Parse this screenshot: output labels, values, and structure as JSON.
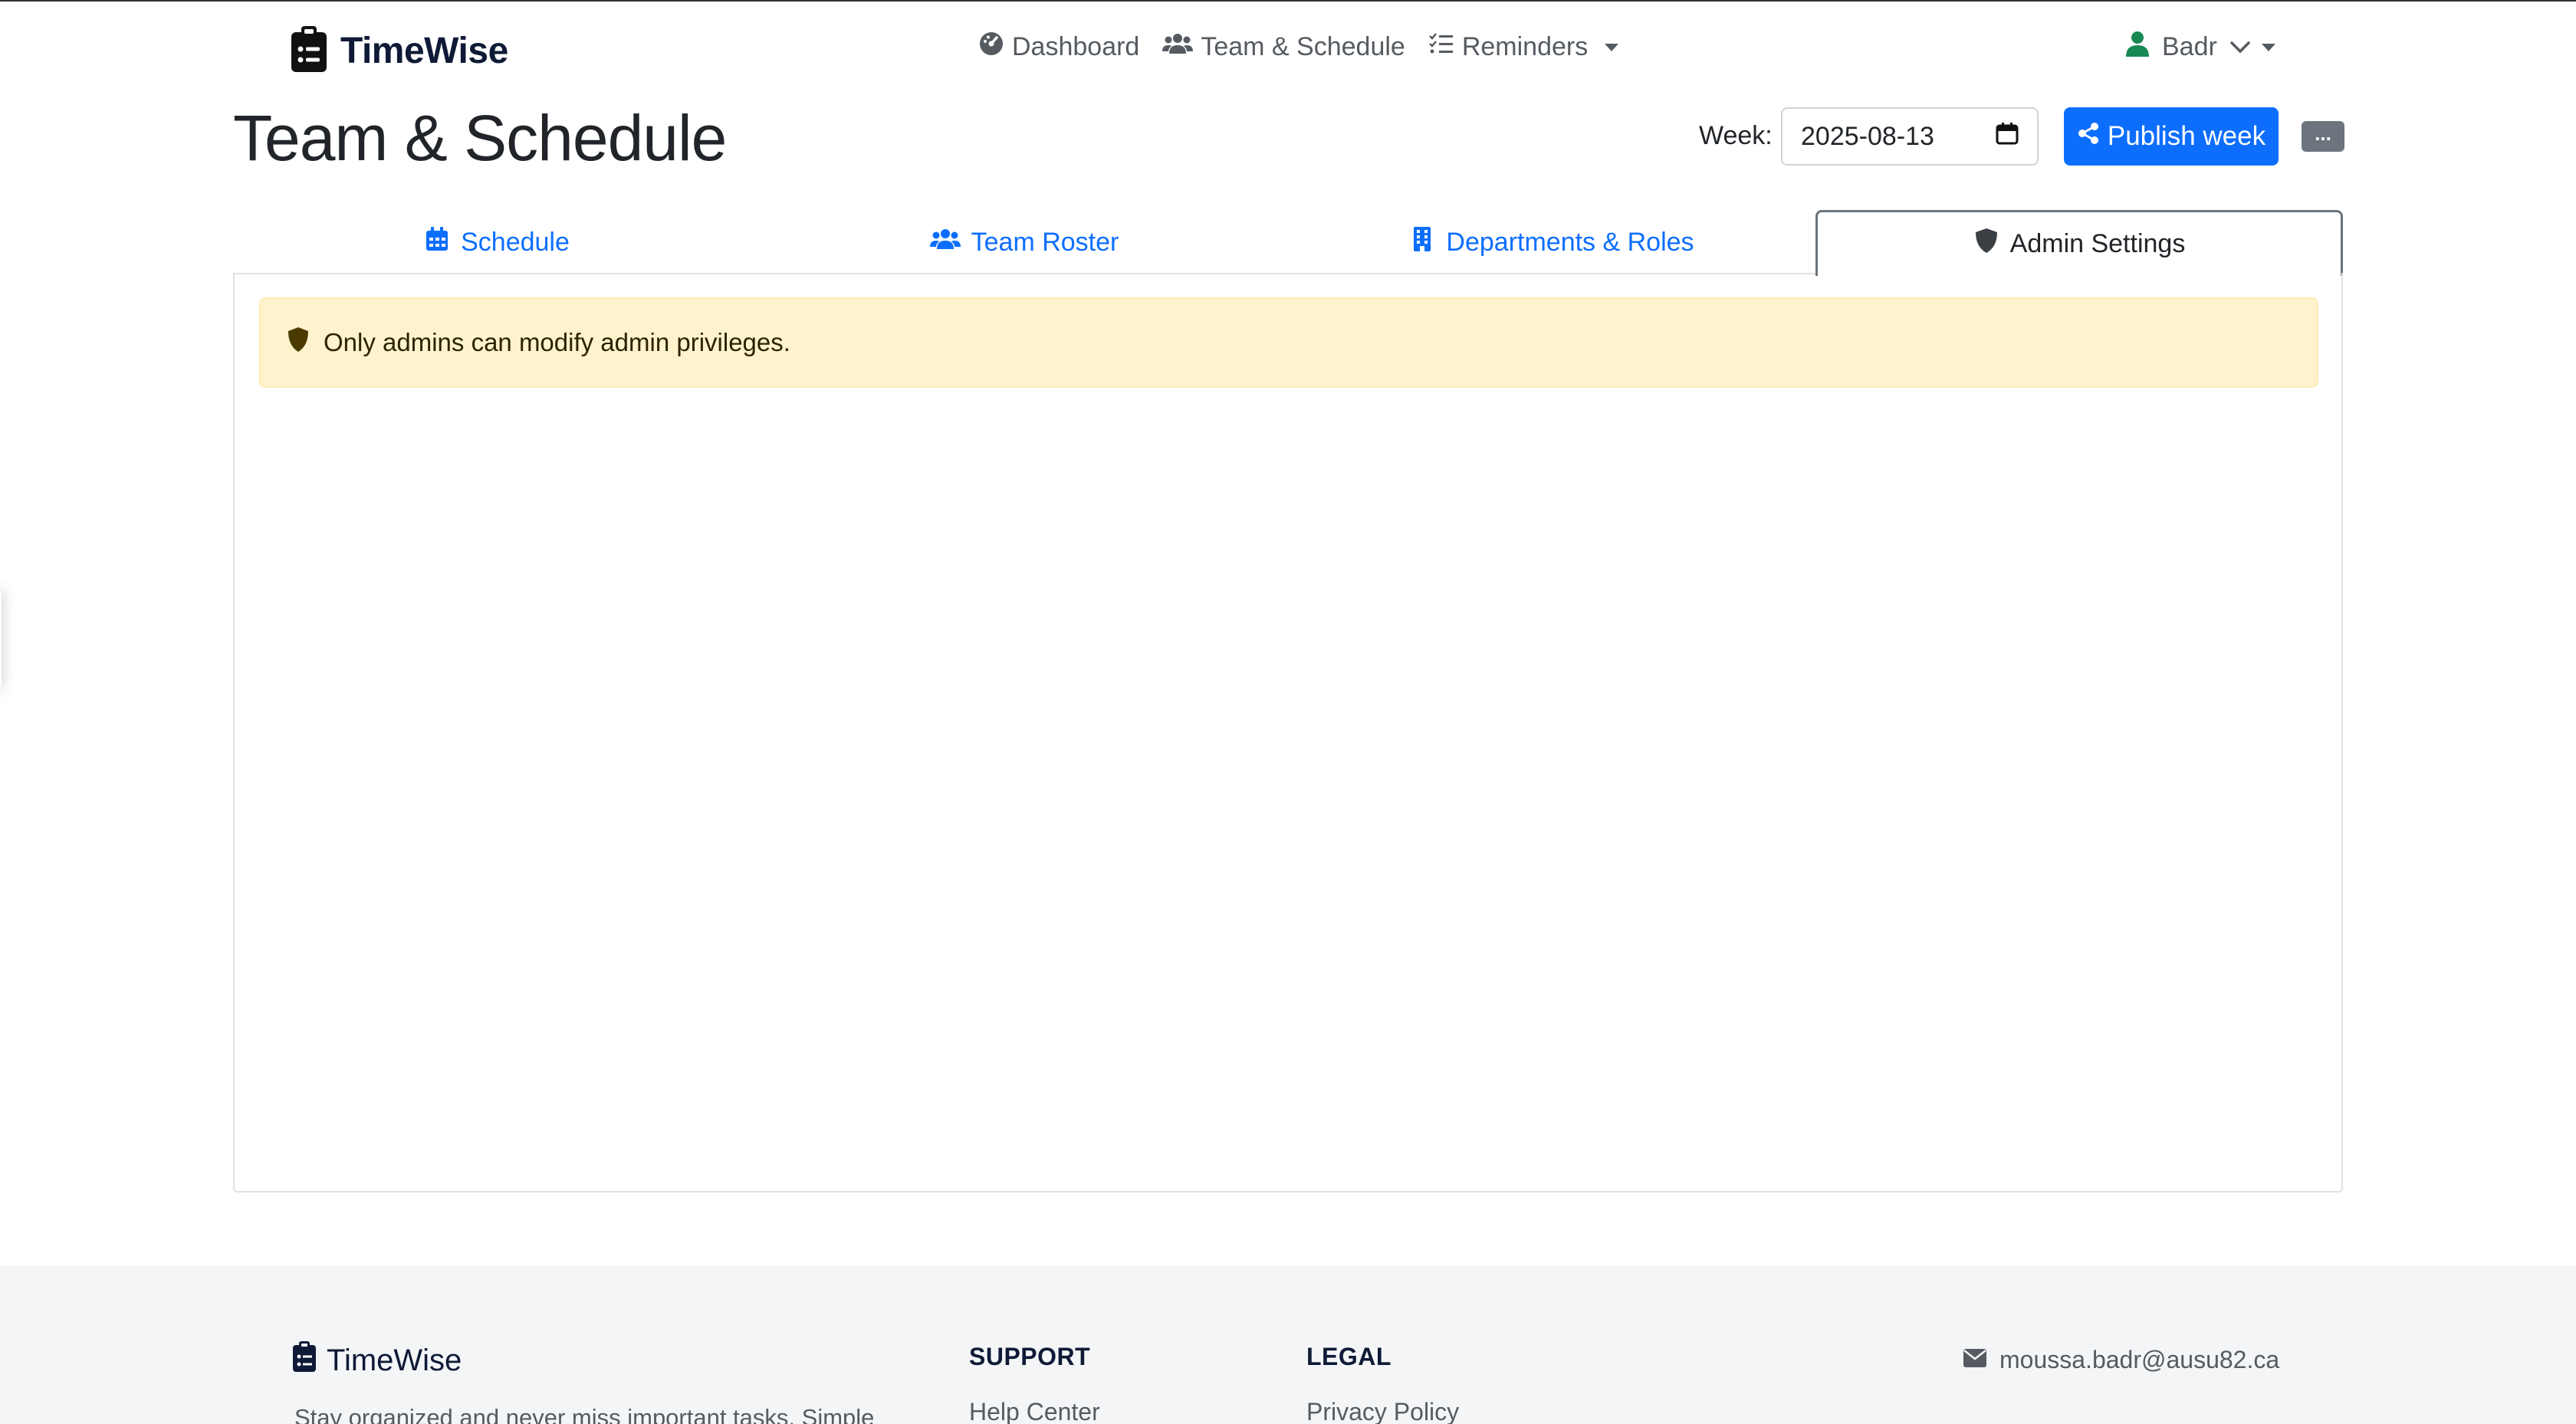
{
  "brand": {
    "name": "TimeWise"
  },
  "nav": {
    "links": [
      {
        "label": "Dashboard",
        "icon": "gauge-icon"
      },
      {
        "label": "Team & Schedule",
        "icon": "users-icon"
      },
      {
        "label": "Reminders",
        "icon": "list-check-icon",
        "dropdown": true
      }
    ]
  },
  "user": {
    "name": "Badr"
  },
  "page": {
    "title": "Team & Schedule",
    "week_label": "Week:",
    "week_value": "2025-08-13",
    "publish_label": "Publish week",
    "more_label": "..."
  },
  "tabs": [
    {
      "label": "Schedule",
      "icon": "calendar-icon",
      "active": false
    },
    {
      "label": "Team Roster",
      "icon": "users-icon",
      "active": false
    },
    {
      "label": "Departments & Roles",
      "icon": "building-icon",
      "active": false
    },
    {
      "label": "Admin Settings",
      "icon": "shield-icon",
      "active": true
    }
  ],
  "alert": {
    "text": "Only admins can modify admin privileges.",
    "icon": "shield-icon"
  },
  "footer": {
    "brand": "TimeWise",
    "description": "Stay organized and never miss important tasks. Simple",
    "support": {
      "title": "SUPPORT",
      "first_link": "Help Center"
    },
    "legal": {
      "title": "LEGAL",
      "first_link": "Privacy Policy"
    },
    "email": "moussa.badr@ausu82.ca"
  },
  "colors": {
    "primary": "#0d6efd",
    "alert_bg": "#fff3cd",
    "footer_bg": "#f4f5f7",
    "user_icon": "#198754",
    "brand_text": "#0e1a36"
  }
}
